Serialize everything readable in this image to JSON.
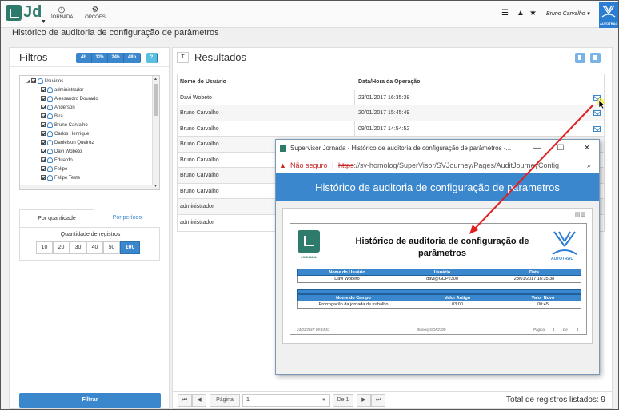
{
  "app": {
    "logo_text": "Jd",
    "nav": [
      {
        "icon": "clock-icon",
        "label": "JORNADA"
      },
      {
        "icon": "gears-icon",
        "label": "OPÇÕES"
      }
    ],
    "user_name": "Bruno Carvalho",
    "brand_text": "AUTOTRAC",
    "page_title": "Histórico de auditoria de configuração de parâmetros"
  },
  "filters": {
    "title": "Filtros",
    "time_buttons": [
      "4h",
      "12h",
      "24h",
      "48h"
    ],
    "tree_root": "Usuários",
    "tree_items": [
      "administrador",
      "Alessandro Dourado",
      "Anderson",
      "Bira",
      "Bruno Carvalho",
      "Carlos Henrique",
      "Danielson Queiroz",
      "Davi Wobeto",
      "Eduardo",
      "Felipe",
      "Felipe Teste"
    ],
    "tabs": [
      "Por quantidade",
      "Por período"
    ],
    "quantity_label": "Quantidade de registros",
    "quantity_options": [
      "10",
      "20",
      "30",
      "40",
      "50",
      "100"
    ],
    "quantity_selected": "100",
    "submit_label": "Filtrar"
  },
  "results": {
    "title": "Resultados",
    "columns": [
      "Nome do Usuário",
      "Data/Hora da Operação"
    ],
    "rows": [
      {
        "user": "Davi Wobeto",
        "date": "23/01/2017 16:35:38"
      },
      {
        "user": "Bruno Carvalho",
        "date": "20/01/2017 15:45:49"
      },
      {
        "user": "Bruno Carvalho",
        "date": "09/01/2017 14:54:52"
      },
      {
        "user": "Bruno Carvalho",
        "date": ""
      },
      {
        "user": "Bruno Carvalho",
        "date": ""
      },
      {
        "user": "Bruno Carvalho",
        "date": ""
      },
      {
        "user": "Bruno Carvalho",
        "date": ""
      },
      {
        "user": "administrador",
        "date": ""
      },
      {
        "user": "administrador",
        "date": ""
      }
    ],
    "pagination": {
      "page_label": "Página",
      "page_value": "1",
      "of_label": "De 1"
    },
    "total_label": "Total de registros listados: 9"
  },
  "popup": {
    "window_title": "Supervisor Jornada - Histórico de auditoria de configuração de parâmetros -...",
    "security": "Não seguro",
    "url_scheme": "https",
    "url_rest": "://sv-homolog/SuperVisor/SVJourney/Pages/AuditJourneyConfig",
    "header": "Histórico de auditoria de configuração de parametros",
    "report": {
      "logo_caption": "JORNADA",
      "title": "Histórico de auditoria de configuração de parâmetros",
      "brand": "AUTOTRAC",
      "table1_headers": [
        "Nome do Usuário",
        "Usuário",
        "Data"
      ],
      "table1_row": [
        "Davi Wobeto",
        "davi@GDP2300",
        "23/01/2017 16:35:38"
      ],
      "table2_headers": [
        "Nome do Campo",
        "Valor Antigo",
        "Valor Novo"
      ],
      "table2_row": [
        "Prorrogação da jornada de trabalho",
        "03:00",
        "00:45"
      ],
      "footer": {
        "printed": "24/01/2017 09:44:53",
        "user": "Bruno@GDP2300",
        "page": "Página",
        "page_num": "1",
        "of": "De",
        "total": "1"
      }
    }
  },
  "colors": {
    "primary": "#3a87cd",
    "jornada_green": "#2e7a6b",
    "danger": "#c62828",
    "arrow": "#e02020"
  }
}
